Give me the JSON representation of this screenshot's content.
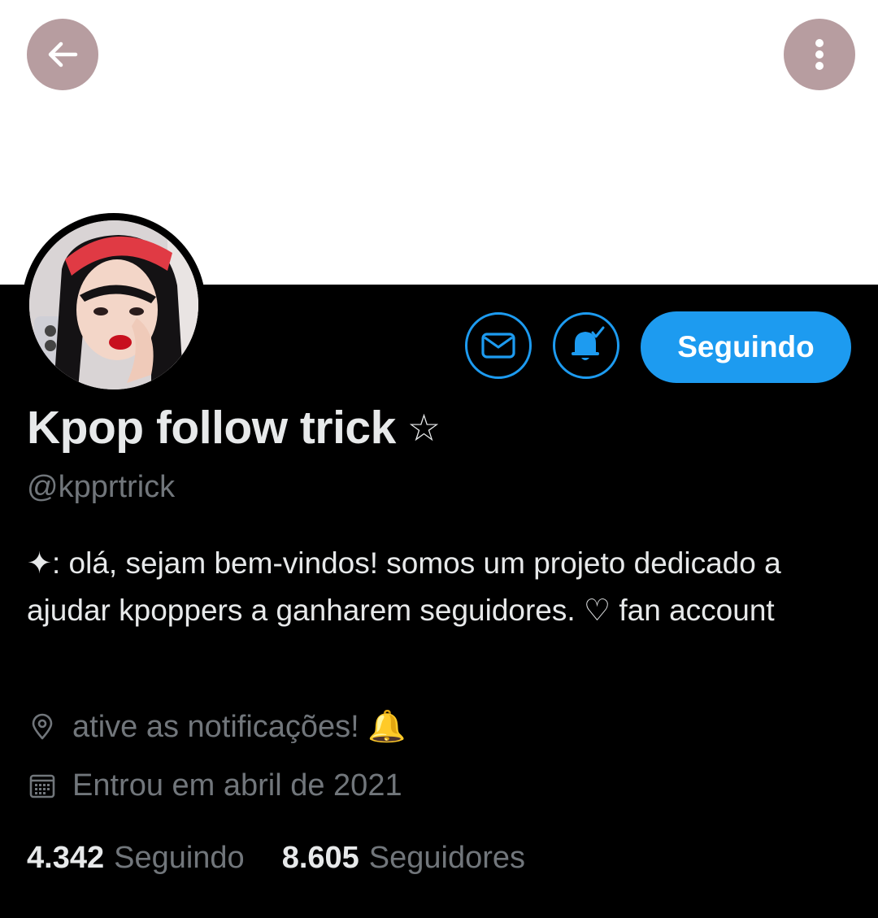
{
  "header": {
    "back_icon": "arrow-left-icon",
    "more_icon": "more-vertical-icon"
  },
  "profile": {
    "display_name": "Kpop follow trick",
    "name_emoji": "☆",
    "handle": "@kpprtrick",
    "bio": "✦: olá, sejam bem-vindos! somos um projeto dedicado a ajudar kpoppers a ganharem seguidores. ♡ fan account",
    "location": "ative as notificações! 🔔",
    "joined": "Entrou em abril de 2021"
  },
  "actions": {
    "dm_icon": "envelope-icon",
    "notif_icon": "bell-check-icon",
    "follow_label": "Seguindo"
  },
  "stats": {
    "following_count": "4.342",
    "following_label": "Seguindo",
    "followers_count": "8.605",
    "followers_label": "Seguidores"
  },
  "colors": {
    "accent": "#1d9bf0",
    "header_button": "#b79da0",
    "background": "#000000",
    "secondary_text": "#71767b"
  }
}
